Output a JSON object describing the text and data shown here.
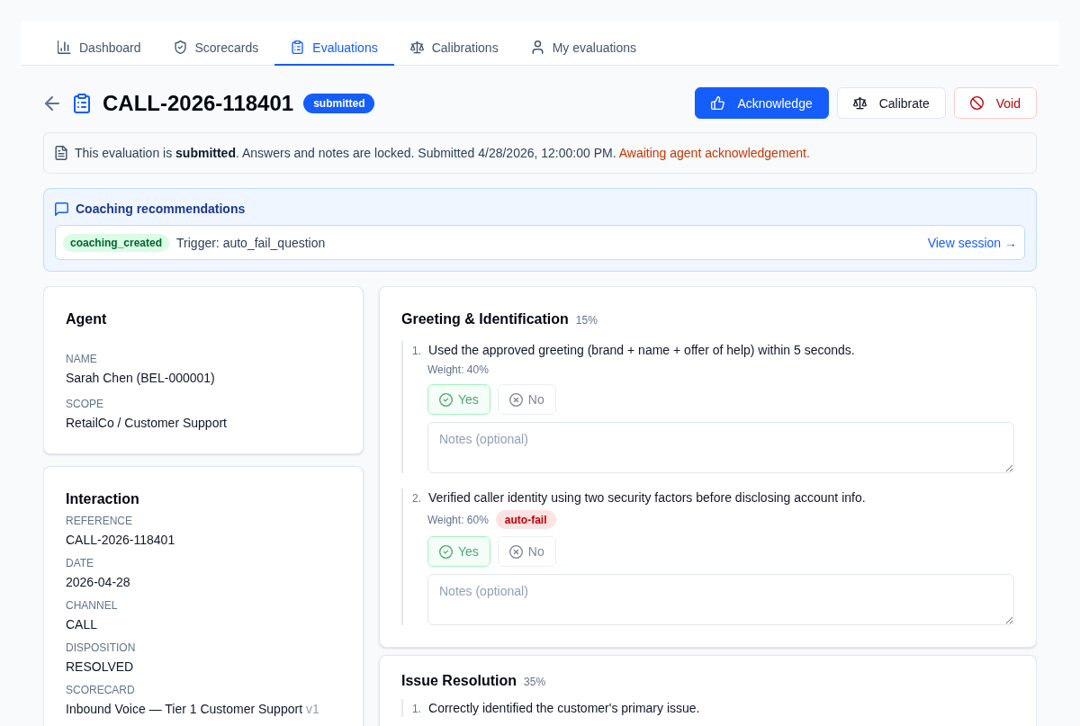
{
  "nav": {
    "tabs": [
      {
        "label": "Dashboard",
        "selected": false
      },
      {
        "label": "Scorecards",
        "selected": false
      },
      {
        "label": "Evaluations",
        "selected": true
      },
      {
        "label": "Calibrations",
        "selected": false
      },
      {
        "label": "My evaluations",
        "selected": false
      }
    ]
  },
  "header": {
    "title": "CALL-2026-118401",
    "status": "submitted",
    "actions": [
      {
        "label": "Acknowledge",
        "kind": "primary"
      },
      {
        "label": "Calibrate",
        "kind": "secondary"
      },
      {
        "label": "Void",
        "kind": "danger"
      }
    ]
  },
  "notice": {
    "text": "This evaluation is **submitted**. Answers and notes are locked. Submitted 4/28/2026, 12:00:00 PM.",
    "note": "Awaiting agent acknowledgement."
  },
  "coaching": {
    "title": "Coaching recommendations",
    "items": [
      {
        "status": "coaching_created",
        "trigger": "Trigger: auto_fail_question",
        "link": "View session →"
      }
    ]
  },
  "agent": {
    "title": "Agent",
    "fields": [
      {
        "label": "NAME",
        "value": "Sarah Chen (BEL-000001)"
      },
      {
        "label": "SCOPE",
        "value": "RetailCo / Customer Support"
      }
    ]
  },
  "interaction": {
    "title": "Interaction",
    "fields": [
      {
        "label": "REFERENCE",
        "value": "CALL-2026-118401"
      },
      {
        "label": "DATE",
        "value": "2026-04-28"
      },
      {
        "label": "CHANNEL",
        "value": "CALL"
      },
      {
        "label": "DISPOSITION",
        "value": "RESOLVED"
      },
      {
        "label": "SCORECARD",
        "value": "Inbound Voice — Tier 1 Customer Support",
        "version": "v1"
      }
    ]
  },
  "sections": [
    {
      "title": "Greeting & Identification",
      "weight": "15%",
      "questions": [
        {
          "number": "1.",
          "text": "Used the approved greeting (brand + name + offer of help) within 5 seconds.",
          "weight": "Weight: 40%",
          "options": [
            {
              "label": "Yes",
              "kind": "yes",
              "selected": true,
              "disabled": true
            },
            {
              "label": "No",
              "kind": "no",
              "selected": false,
              "disabled": true
            }
          ],
          "notes": {
            "placeholder": "Notes (optional)"
          }
        },
        {
          "number": "2.",
          "text": "Verified caller identity using two security factors before disclosing account info.",
          "weight": "Weight: 60%",
          "tag": "auto-fail",
          "options": [
            {
              "label": "Yes",
              "kind": "yes",
              "selected": true,
              "disabled": true
            },
            {
              "label": "No",
              "kind": "no",
              "selected": false,
              "disabled": true
            }
          ],
          "notes": {
            "placeholder": "Notes (optional)"
          }
        }
      ]
    },
    {
      "title": "Issue Resolution",
      "weight": "35%",
      "questions": [
        {
          "number": "1.",
          "text": "Correctly identified the customer's primary issue."
        }
      ]
    }
  ]
}
